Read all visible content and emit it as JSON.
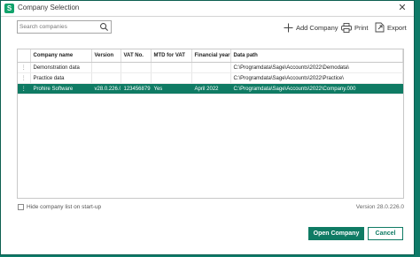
{
  "window": {
    "title": "Company Selection",
    "app_icon_letter": "S",
    "close_glyph": "✕"
  },
  "search": {
    "placeholder": "Search companies",
    "icon": "search-icon"
  },
  "toolbar": {
    "add_label": "Add Company",
    "print_label": "Print",
    "export_label": "Export"
  },
  "table": {
    "columns": [
      "",
      "Company name",
      "Version",
      "VAT No.",
      "MTD for VAT",
      "Financial year",
      "Data path"
    ],
    "rows": [
      {
        "handle": "⋮",
        "name": "Demonstration data",
        "version": "",
        "vat": "",
        "mtd": "",
        "fy": "",
        "path": "C:\\Programdata\\Sage\\Accounts\\2022\\Demodata\\",
        "selected": false
      },
      {
        "handle": "⋮",
        "name": "Practice data",
        "version": "",
        "vat": "",
        "mtd": "",
        "fy": "",
        "path": "C:\\Programdata\\Sage\\Accounts\\2022\\Practice\\",
        "selected": false
      },
      {
        "handle": "⋮",
        "name": "Prohire Software",
        "version": "v28.0.226.0",
        "vat": "123456879",
        "mtd": "Yes",
        "fy": "April 2022",
        "path": "C:\\Programdata\\Sage\\Accounts\\2022\\Company.000",
        "selected": true
      }
    ]
  },
  "footer": {
    "hide_label": "Hide company list on start-up",
    "hide_checked": false,
    "version_text": "Version 28.0.226.0",
    "open_label": "Open Company",
    "cancel_label": "Cancel"
  },
  "colors": {
    "accent": "#0f7b64",
    "app_icon": "#11a36b",
    "background": "#0e7a68"
  }
}
